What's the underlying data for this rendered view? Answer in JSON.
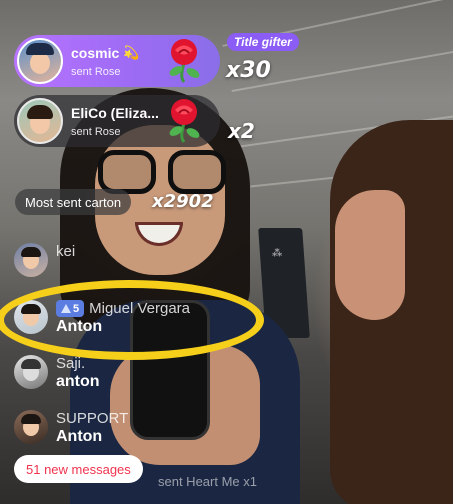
{
  "gifts": [
    {
      "user": "cosmic",
      "action": "sent Rose",
      "count": "x30",
      "badge": "Title gifter",
      "icon": "rose-icon"
    },
    {
      "user": "EliCo (Eliza...",
      "action": "sent Rose",
      "count": "x2",
      "icon": "rose-icon"
    }
  ],
  "most_sent": {
    "label": "Most sent carton",
    "count": "x2902"
  },
  "chat": [
    {
      "user": "kei",
      "message": ""
    },
    {
      "user": "Miguel Vergara",
      "level": "5",
      "message": "Anton",
      "highlighted": true
    },
    {
      "user": "Saji.",
      "message": "anton"
    },
    {
      "user": "SUPPORT",
      "message": "Anton"
    }
  ],
  "new_messages": "51 new messages",
  "ghost_gift": "sent Heart Me x1",
  "colors": {
    "gifter_purple": "#b874ff",
    "highlight": "#f6cf1a",
    "new_messages_text": "#f0334e",
    "level_badge": "#5b7ce0"
  }
}
